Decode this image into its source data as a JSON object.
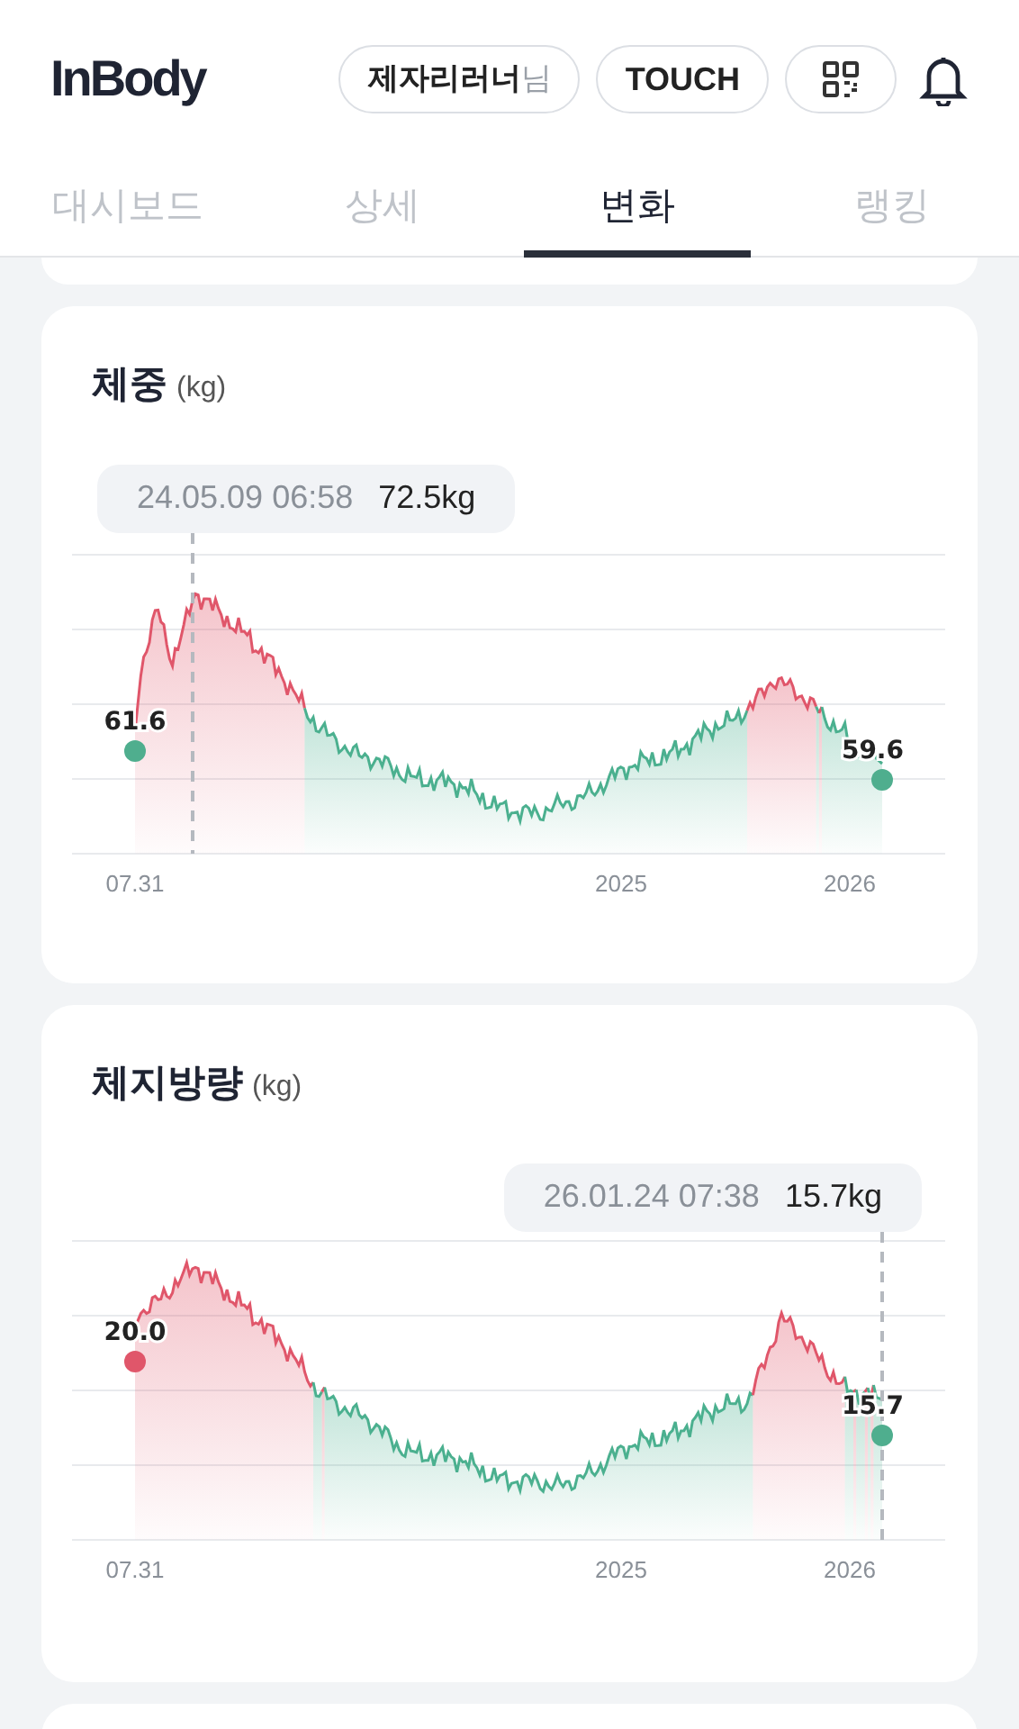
{
  "header": {
    "logo": "InBody",
    "user_name": "제자리러너",
    "user_suffix": "님",
    "touch_button": "TOUCH"
  },
  "tabs": [
    {
      "label": "대시보드",
      "selected": false
    },
    {
      "label": "상세",
      "selected": false
    },
    {
      "label": "변화",
      "selected": true
    },
    {
      "label": "랭킹",
      "selected": false
    }
  ],
  "cards": [
    {
      "title": "체중",
      "unit": "(kg)",
      "tooltip": {
        "date": "24.05.09 06:58",
        "value": "72.5kg"
      },
      "start_point": {
        "value": "61.6",
        "color": "#4fae8e"
      },
      "end_point": {
        "value": "59.6",
        "color": "#4fae8e"
      },
      "x_labels": [
        "07.31",
        "2025",
        "2026"
      ]
    },
    {
      "title": "체지방량",
      "unit": "(kg)",
      "tooltip": {
        "date": "26.01.24 07:38",
        "value": "15.7kg"
      },
      "start_point": {
        "value": "20.0",
        "color": "#e0566a"
      },
      "end_point": {
        "value": "15.7",
        "color": "#4fae8e"
      },
      "x_labels": [
        "07.31",
        "2025",
        "2026"
      ]
    }
  ]
}
